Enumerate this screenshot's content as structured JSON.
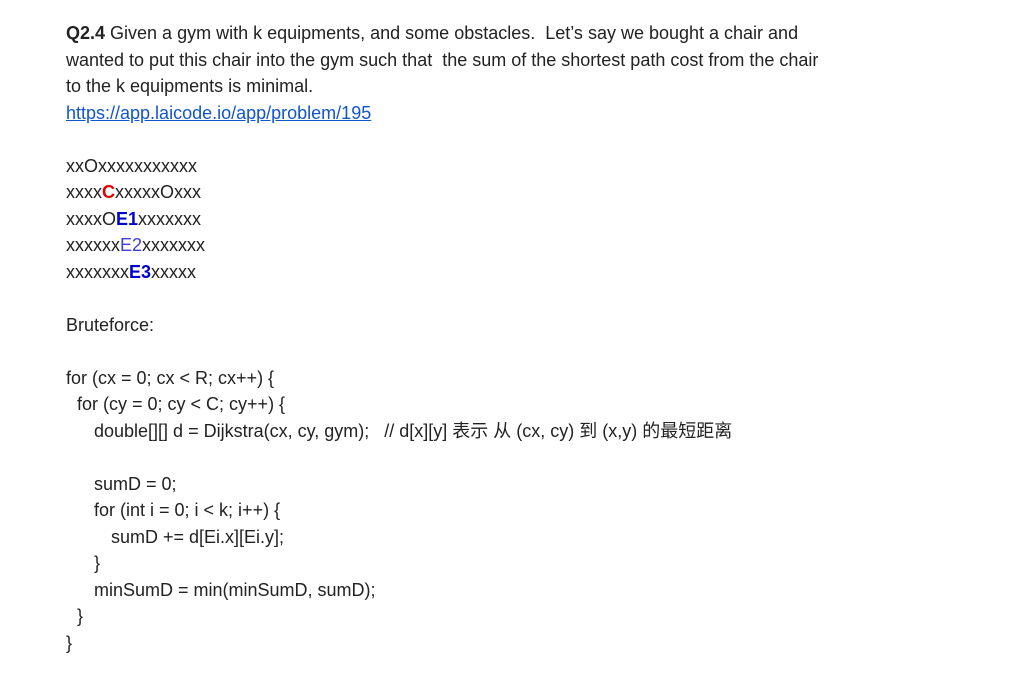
{
  "question": {
    "label": "Q2.4",
    "text_line1": " Given a gym with k equipments, and some obstacles.  Let’s say we bought a chair and",
    "text_line2": "wanted to put this chair into the gym such that  the sum of the shortest path cost from the chair",
    "text_line3": "to the k equipments is minimal.",
    "link": "https://app.laicode.io/app/problem/195"
  },
  "grid": {
    "row1": "xxOxxxxxxxxxxx",
    "row2": {
      "pre": "xxxx",
      "mark": "C",
      "post": "xxxxxOxxx"
    },
    "row3": {
      "pre": "xxxxO",
      "mark": "E1",
      "post": "xxxxxxx"
    },
    "row4": {
      "pre": "xxxxxx",
      "mark": "E2",
      "post": "xxxxxxx"
    },
    "row5": {
      "pre": "xxxxxxx",
      "mark": "E3",
      "post": "xxxxx"
    }
  },
  "bruteforce_label": "Bruteforce:",
  "code": {
    "l1": "for (cx = 0; cx < R; cx++) {",
    "l2": "for (cy = 0; cy < C; cy++) {",
    "l3": "double[][] d = Dijkstra(cx, cy, gym);   // d[x][y] 表示 从 (cx, cy) 到 (x,y) 的最短距离",
    "l4": "sumD = 0;",
    "l5": "for (int i = 0; i < k; i++) {",
    "l6": "sumD += d[Ei.x][Ei.y];",
    "l7": "}",
    "l8": "minSumD = min(minSumD, sumD);",
    "l9": "}",
    "l10": "}"
  },
  "colors": {
    "chair": "#e00000",
    "equipment_bold": "#0000cc",
    "equipment_plain": "#3d3dd8",
    "link": "#1155cc"
  }
}
